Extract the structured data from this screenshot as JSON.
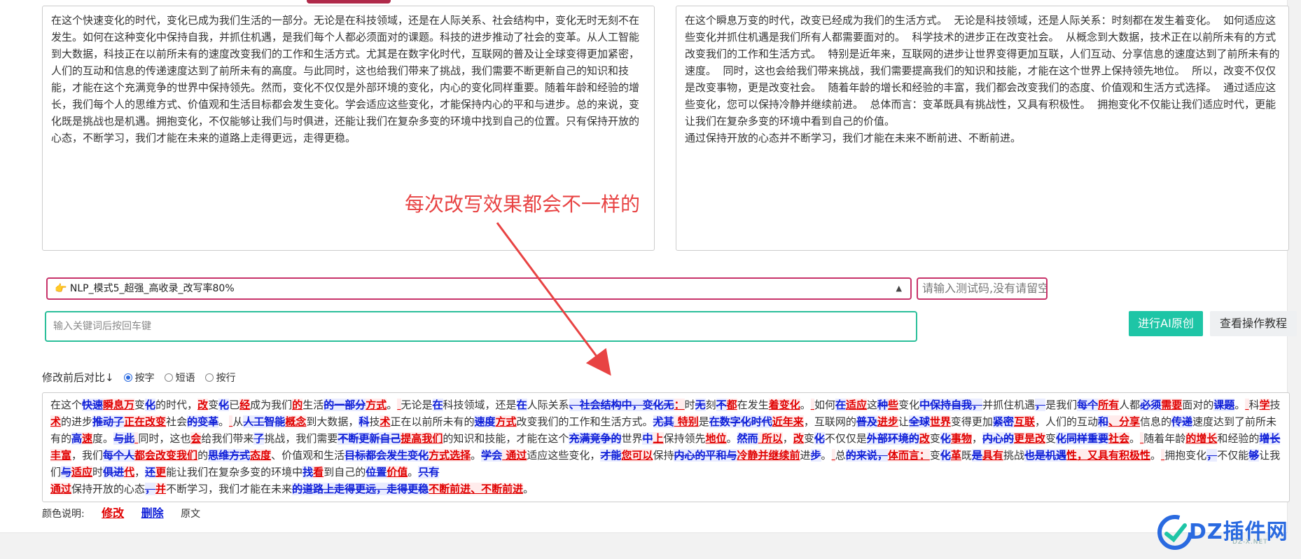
{
  "input_text": "在这个快速变化的时代，变化已成为我们生活的一部分。无论是在科技领域，还是在人际关系、社会结构中，变化无时无刻不在发生。如何在这种变化中保持自我，并抓住机遇，是我们每个人都必须面对的课题。科技的进步推动了社会的变革。从人工智能到大数据，科技正在以前所未有的速度改变我们的工作和生活方式。尤其是在数字化时代，互联网的普及让全球变得更加紧密，人们的互动和信息的传递速度达到了前所未有的高度。与此同时，这也给我们带来了挑战，我们需要不断更新自己的知识和技能，才能在这个充满竞争的世界中保持领先。然而，变化不仅仅是外部环境的变化，内心的变化同样重要。随着年龄和经验的增长，我们每个人的思维方式、价值观和生活目标都会发生变化。学会适应这些变化，才能保持内心的平和与进步。总的来说，变化既是挑战也是机遇。拥抱变化，不仅能够让我们与时俱进，还能让我们在复杂多变的环境中找到自己的位置。只有保持开放的心态，不断学习，我们才能在未来的道路上走得更远，走得更稳。",
  "output_text": "在这个瞬息万变的时代，改变已经成为我们的生活方式。  无论是科技领域，还是人际关系：时刻都在发生着变化。  如何适应这些变化并抓住机遇是我们所有人都需要面对的。  科学技术的进步正在改变社会。  从概念到大数据，技术正在以前所未有的方式改变我们的工作和生活方式。  特别是近年来，互联网的进步让世界变得更加互联，人们互动、分享信息的速度达到了前所未有的速度。  同时，这也会给我们带来挑战，我们需要提高我们的知识和技能，才能在这个世界上保持领先地位。  所以，改变不仅仅是改变事物，更是改变社会。  随着年龄的增长和经验的丰富，我们都会改变我们的态度、价值观和生活方式选择。  通过适应这些变化，您可以保持冷静并继续前进。  总体而言：变革既具有挑战性，又具有积极性。  拥抱变化不仅能让我们适应时代，更能让我们在复杂多变的环境中看到自己的价值。\n通过保持开放的心态并不断学习，我们才能在未来不断前进、不断前进。",
  "annotation_text": "每次改写效果都会不一样的",
  "mode_select": "👉 NLP_模式5_超强_高收录_改写率80%",
  "test_code_placeholder": "请输入测试码,没有请留空",
  "keyword_placeholder": "输入关键词后按回车键",
  "buttons": {
    "ai": "进行AI原创",
    "tutorial": "查看操作教程"
  },
  "compare": {
    "label": "修改前后对比↓",
    "options": [
      {
        "label": "按字",
        "checked": true
      },
      {
        "label": "短语",
        "checked": false
      },
      {
        "label": "按行",
        "checked": false
      }
    ]
  },
  "diff": [
    [
      "n",
      "在这个"
    ],
    [
      "d",
      "快速"
    ],
    [
      "m",
      "瞬息万"
    ],
    [
      "n",
      "变"
    ],
    [
      "d",
      "化"
    ],
    [
      "n",
      "的时代，"
    ],
    [
      "m",
      "改"
    ],
    [
      "n",
      "变"
    ],
    [
      "d",
      "化"
    ],
    [
      "n",
      "已"
    ],
    [
      "m",
      "经"
    ],
    [
      "n",
      "成为我们"
    ],
    [
      "m",
      "的"
    ],
    [
      "n",
      "生活"
    ],
    [
      "d",
      "的一部分"
    ],
    [
      "m",
      "方式"
    ],
    [
      "n",
      "。"
    ],
    [
      "m",
      "  "
    ],
    [
      "n",
      "无论是"
    ],
    [
      "d",
      "在"
    ],
    [
      "n",
      "科技领域，还是"
    ],
    [
      "d",
      "在"
    ],
    [
      "n",
      "人际关系"
    ],
    [
      "d",
      "、社会结构中，变化无"
    ],
    [
      "m",
      "："
    ],
    [
      "n",
      "时"
    ],
    [
      "d",
      "无"
    ],
    [
      "n",
      "刻"
    ],
    [
      "d",
      "不"
    ],
    [
      "m",
      "都"
    ],
    [
      "n",
      "在发生"
    ],
    [
      "m",
      "着变化"
    ],
    [
      "n",
      "。"
    ],
    [
      "m",
      "  "
    ],
    [
      "n",
      "如何"
    ],
    [
      "d",
      "在"
    ],
    [
      "m",
      "适应"
    ],
    [
      "n",
      "这"
    ],
    [
      "d",
      "种"
    ],
    [
      "m",
      "些"
    ],
    [
      "n",
      "变化"
    ],
    [
      "d",
      "中保持自我，"
    ],
    [
      "n",
      "并抓住机遇"
    ],
    [
      "d",
      "，"
    ],
    [
      "n",
      "是我们"
    ],
    [
      "d",
      "每个"
    ],
    [
      "m",
      "所有"
    ],
    [
      "n",
      "人都"
    ],
    [
      "d",
      "必须"
    ],
    [
      "m",
      "需要"
    ],
    [
      "n",
      "面对的"
    ],
    [
      "d",
      "课题"
    ],
    [
      "n",
      "。"
    ],
    [
      "m",
      "  "
    ],
    [
      "n",
      "科"
    ],
    [
      "m",
      "学"
    ],
    [
      "n",
      "技"
    ],
    [
      "m",
      "术"
    ],
    [
      "n",
      "的进步"
    ],
    [
      "d",
      "推动了"
    ],
    [
      "m",
      "正在改变"
    ],
    [
      "n",
      "社会"
    ],
    [
      "d",
      "的变革"
    ],
    [
      "n",
      "。"
    ],
    [
      "m",
      "  "
    ],
    [
      "n",
      "从"
    ],
    [
      "d",
      "人工智能"
    ],
    [
      "m",
      "概念"
    ],
    [
      "n",
      "到大数据，"
    ],
    [
      "d",
      "科"
    ],
    [
      "n",
      "技"
    ],
    [
      "m",
      "术"
    ],
    [
      "n",
      "正在以前所未有的"
    ],
    [
      "d",
      "速度"
    ],
    [
      "m",
      "方式"
    ],
    [
      "n",
      "改变我们的工作和生活方式。"
    ],
    [
      "d",
      "尤其"
    ],
    [
      "m",
      "  特别"
    ],
    [
      "n",
      "是"
    ],
    [
      "d",
      "在数字化时代"
    ],
    [
      "m",
      "近年来"
    ],
    [
      "n",
      "，互联网的"
    ],
    [
      "d",
      "普及"
    ],
    [
      "m",
      "进步"
    ],
    [
      "n",
      "让"
    ],
    [
      "d",
      "全球"
    ],
    [
      "m",
      "世界"
    ],
    [
      "n",
      "变得更加"
    ],
    [
      "d",
      "紧密"
    ],
    [
      "m",
      "互联"
    ],
    [
      "n",
      "，人们的互动"
    ],
    [
      "d",
      "和"
    ],
    [
      "m",
      "、分享"
    ],
    [
      "n",
      "信息的"
    ],
    [
      "d",
      "传递"
    ],
    [
      "n",
      "速度达到了前所未有的"
    ],
    [
      "d",
      "高"
    ],
    [
      "m",
      "速"
    ],
    [
      "n",
      "度。"
    ],
    [
      "d",
      "与此"
    ],
    [
      "m",
      "  "
    ],
    [
      "n",
      "同时，这也"
    ],
    [
      "m",
      "会"
    ],
    [
      "n",
      "给我们带来"
    ],
    [
      "d",
      "了"
    ],
    [
      "n",
      "挑战，我们需要"
    ],
    [
      "d",
      "不断更新自己"
    ],
    [
      "m",
      "提高我们"
    ],
    [
      "n",
      "的知识和技能，才能在这个"
    ],
    [
      "d",
      "充满竞争的"
    ],
    [
      "n",
      "世界"
    ],
    [
      "d",
      "中"
    ],
    [
      "m",
      "上"
    ],
    [
      "n",
      "保持领先"
    ],
    [
      "m",
      "地位"
    ],
    [
      "n",
      "。"
    ],
    [
      "d",
      "然而"
    ],
    [
      "m",
      "  所以"
    ],
    [
      "n",
      "，"
    ],
    [
      "m",
      "改"
    ],
    [
      "n",
      "变"
    ],
    [
      "d",
      "化"
    ],
    [
      "n",
      "不仅仅是"
    ],
    [
      "d",
      "外部环境的"
    ],
    [
      "m",
      "改"
    ],
    [
      "n",
      "变"
    ],
    [
      "d",
      "化"
    ],
    [
      "m",
      "事物"
    ],
    [
      "n",
      "，"
    ],
    [
      "d",
      "内心的"
    ],
    [
      "m",
      "更是改"
    ],
    [
      "n",
      "变"
    ],
    [
      "d",
      "化同样重要"
    ],
    [
      "m",
      "社会"
    ],
    [
      "n",
      "。"
    ],
    [
      "m",
      "  "
    ],
    [
      "n",
      "随着年龄"
    ],
    [
      "m",
      "的增长"
    ],
    [
      "n",
      "和经验的"
    ],
    [
      "d",
      "增长"
    ],
    [
      "m",
      "丰富"
    ],
    [
      "n",
      "，我们"
    ],
    [
      "d",
      "每个人"
    ],
    [
      "m",
      "都会改变我们"
    ],
    [
      "n",
      "的"
    ],
    [
      "d",
      "思维方式"
    ],
    [
      "m",
      "态度"
    ],
    [
      "n",
      "、价值观和生活"
    ],
    [
      "d",
      "目标都会发生变化"
    ],
    [
      "m",
      "方式选择"
    ],
    [
      "n",
      "。"
    ],
    [
      "d",
      "学会"
    ],
    [
      "m",
      "  通过"
    ],
    [
      "n",
      "适应这些变化，"
    ],
    [
      "d",
      "才能"
    ],
    [
      "m",
      "您可以"
    ],
    [
      "n",
      "保持"
    ],
    [
      "d",
      "内心的平和与"
    ],
    [
      "m",
      "冷静并继续前"
    ],
    [
      "n",
      "进"
    ],
    [
      "d",
      "步"
    ],
    [
      "n",
      "。"
    ],
    [
      "m",
      "  "
    ],
    [
      "n",
      "总"
    ],
    [
      "d",
      "的来说，"
    ],
    [
      "m",
      "体而言："
    ],
    [
      "n",
      "变"
    ],
    [
      "d",
      "化"
    ],
    [
      "m",
      "革"
    ],
    [
      "n",
      "既"
    ],
    [
      "d",
      "是"
    ],
    [
      "m",
      "具有"
    ],
    [
      "n",
      "挑战"
    ],
    [
      "d",
      "也是机遇"
    ],
    [
      "m",
      "性，又具有积极性"
    ],
    [
      "n",
      "。"
    ],
    [
      "m",
      "  "
    ],
    [
      "n",
      "拥抱变化"
    ],
    [
      "d",
      "，"
    ],
    [
      "n",
      "不仅能"
    ],
    [
      "d",
      "够"
    ],
    [
      "n",
      "让我们"
    ],
    [
      "d",
      "与"
    ],
    [
      "m",
      "适应"
    ],
    [
      "n",
      "时"
    ],
    [
      "d",
      "俱进"
    ],
    [
      "m",
      "代"
    ],
    [
      "n",
      "，"
    ],
    [
      "d",
      "还"
    ],
    [
      "m",
      "更"
    ],
    [
      "n",
      "能让我们在复杂多变的环境中"
    ],
    [
      "d",
      "找"
    ],
    [
      "m",
      "看"
    ],
    [
      "n",
      "到自己的"
    ],
    [
      "d",
      "位置"
    ],
    [
      "m",
      "价值"
    ],
    [
      "n",
      "。"
    ],
    [
      "d",
      "只有"
    ],
    [
      "m",
      "\n通过"
    ],
    [
      "n",
      "保持开放的心态"
    ],
    [
      "d",
      "，"
    ],
    [
      "m",
      "并"
    ],
    [
      "n",
      "不断学习，我们才能在未来"
    ],
    [
      "d",
      "的道路上走得更远，走得更稳"
    ],
    [
      "m",
      "不断前进、不断前进"
    ],
    [
      "n",
      "。"
    ]
  ],
  "legend": {
    "title": "颜色说明:",
    "modify": "修改",
    "delete": "删除",
    "original": "原文"
  },
  "logo": {
    "text": "DZ插件网",
    "sub": "DZ-X.NET"
  },
  "colors": {
    "modify": "#e00000",
    "delete": "#1020d8",
    "accent_green": "#1ec5a6",
    "accent_pink": "#c8336a",
    "annotation": "#e84343"
  }
}
